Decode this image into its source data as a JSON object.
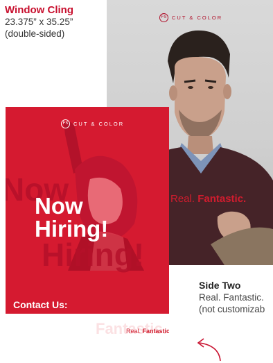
{
  "header": {
    "title": "Window Cling",
    "dimensions": "23.375” x 35.25”",
    "note": "(double-sided)"
  },
  "poster_back": {
    "logo_mark": "FS",
    "logo_text": "CUT & COLOR",
    "tagline_light": "Real. ",
    "tagline_bold": "Fantastic.",
    "accent": "#d11c2e"
  },
  "poster_front": {
    "logo_mark": "FS",
    "logo_text": "CUT & COLOR",
    "headline_line1": "Now",
    "headline_line2": "Hiring!",
    "contact_label": "Contact Us:",
    "tagline_light": "Real. ",
    "tagline_bold": "Fantastic.",
    "background": "#d51a30"
  },
  "side_two": {
    "title": "Side Two",
    "description": "Real. Fantastic.",
    "note": "(not customizab"
  },
  "icons": {
    "arrow": "curved-arrow-icon"
  }
}
